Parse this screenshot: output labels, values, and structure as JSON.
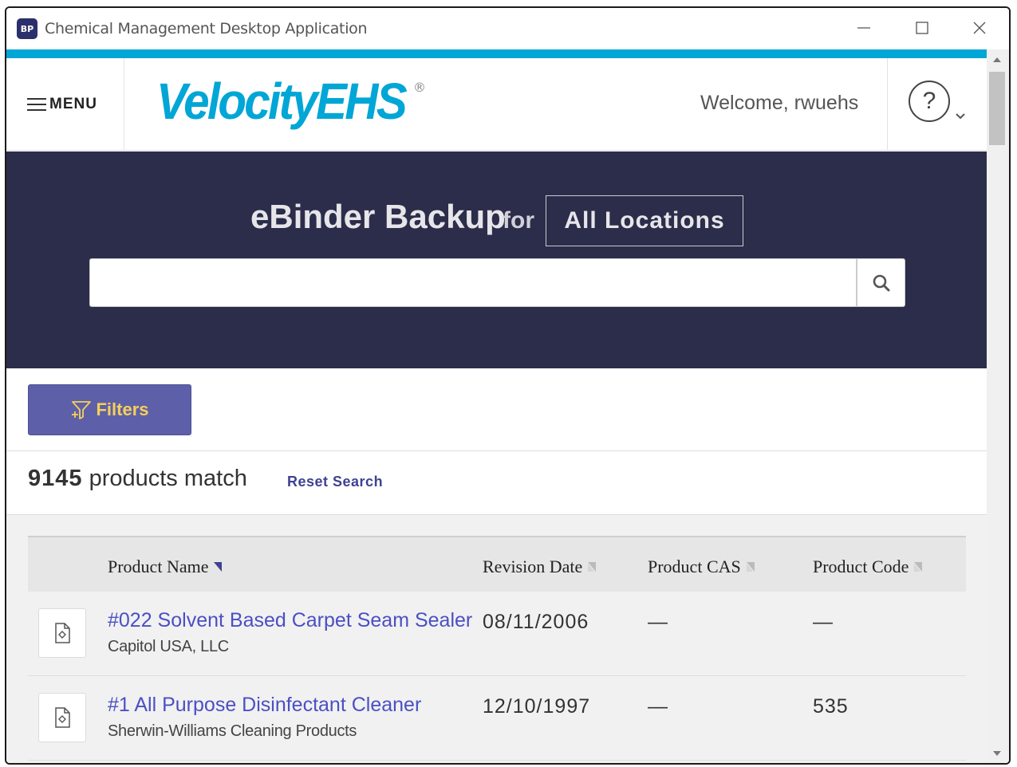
{
  "window": {
    "title": "Chemical Management Desktop Application",
    "app_icon_text": "BP"
  },
  "header": {
    "menu_label": "MENU",
    "logo_text": "VelocityEHS",
    "logo_registered": "®",
    "welcome": "Welcome, rwuehs",
    "help_glyph": "?"
  },
  "hero": {
    "title": "eBinder Backup",
    "for_label": "for",
    "location": "All Locations",
    "search": {
      "value": "",
      "placeholder": ""
    }
  },
  "filters": {
    "label": "Filters"
  },
  "results": {
    "count": "9145",
    "count_suffix": "products match",
    "reset_label": "Reset Search"
  },
  "table": {
    "columns": {
      "name": "Product Name",
      "revision": "Revision Date",
      "cas": "Product CAS",
      "code": "Product Code"
    },
    "rows": [
      {
        "name": "#022 Solvent Based Carpet Seam Sealer",
        "manufacturer": "Capitol USA, LLC",
        "revision": "08/11/2006",
        "cas": "—",
        "code": "—"
      },
      {
        "name": "#1 All Purpose Disinfectant Cleaner",
        "manufacturer": "Sherwin-Williams Cleaning Products",
        "revision": "12/10/1997",
        "cas": "—",
        "code": "535"
      }
    ]
  },
  "colors": {
    "accent": "#00a6d6",
    "hero_bg": "#2c2d4a",
    "filters_bg": "#5d60a8",
    "filters_text": "#f6cf5a",
    "link": "#4b4fc4"
  }
}
